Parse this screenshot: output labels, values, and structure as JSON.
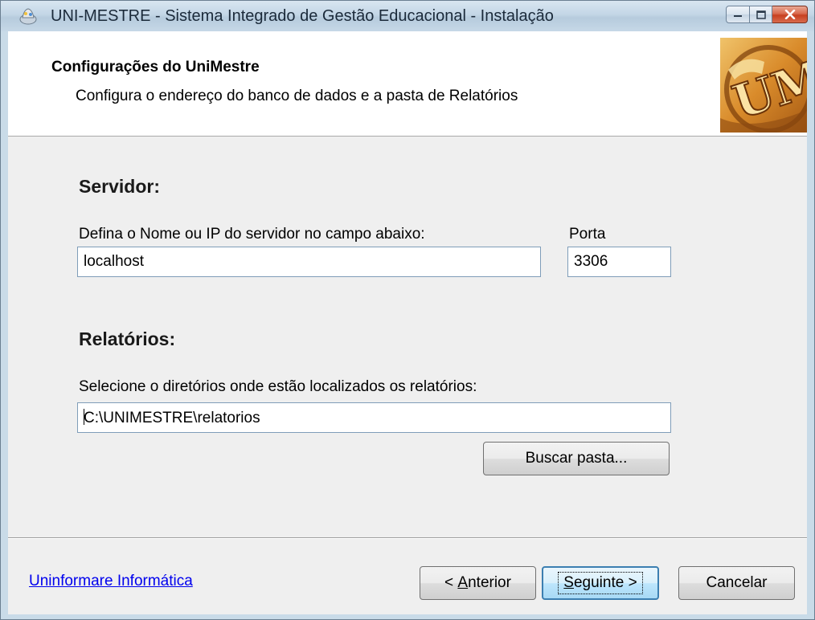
{
  "window": {
    "title": "UNI-MESTRE - Sistema Integrado de Gestão Educacional - Instalação"
  },
  "header": {
    "title": "Configurações do UniMestre",
    "subtitle": "Configura o endereço do banco de dados e a pasta de Relatórios"
  },
  "server": {
    "section_title": "Servidor:",
    "host_label": "Defina o Nome ou IP do servidor no campo abaixo:",
    "host_value": "localhost",
    "port_label": "Porta",
    "port_value": "3306"
  },
  "reports": {
    "section_title": "Relatórios:",
    "dir_label": "Selecione o diretórios onde estão localizados os relatórios:",
    "dir_value": "C:\\UNIMESTRE\\relatorios",
    "browse_button": "Buscar pasta..."
  },
  "footer": {
    "link": "Uninformare Informática",
    "back_prefix": "< ",
    "back_mnemonic": "A",
    "back_rest": "nterior",
    "next_mnemonic": "S",
    "next_rest": "eguinte >",
    "cancel": "Cancelar"
  },
  "icons": {
    "app": "app-icon",
    "minimize": "minimize-icon",
    "maximize": "maximize-icon",
    "close": "close-icon",
    "logo": "unimestre-logo"
  },
  "colors": {
    "link": "#0000ee",
    "default_button_border": "#3c7fb1",
    "close_button": "#c7401f"
  }
}
